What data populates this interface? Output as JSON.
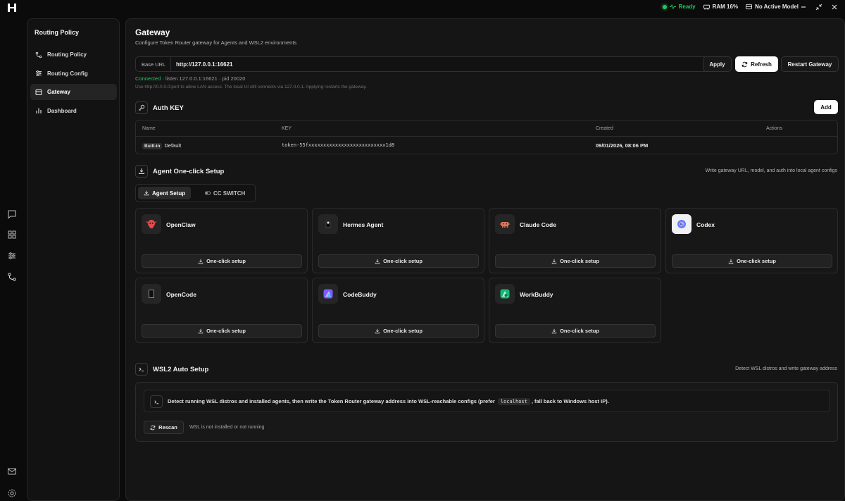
{
  "topbar": {
    "status": "Ready",
    "ram": "RAM 16%",
    "model": "No Active Model"
  },
  "sidebar": {
    "title": "Routing Policy",
    "items": [
      {
        "label": "Routing Policy",
        "icon": "route-icon"
      },
      {
        "label": "Routing Config",
        "icon": "sliders-icon"
      },
      {
        "label": "Gateway",
        "icon": "gateway-icon",
        "active": true
      },
      {
        "label": "Dashboard",
        "icon": "bar-chart-icon"
      }
    ]
  },
  "gateway": {
    "title": "Gateway",
    "subtitle": "Configure Token Router gateway for Agents and WSL2 environments",
    "base_url_label": "Base URL",
    "base_url_value": "http://127.0.0.1:16621",
    "apply_label": "Apply",
    "refresh_label": "Refresh",
    "restart_label": "Restart Gateway",
    "connected": "Connected",
    "listen_info": " · listen 127.0.0.1:16621 · pid 20020",
    "hint": "Use http://0.0.0.0:port to allow LAN access. The local UI still connects via 127.0.0.1. Applying restarts the gateway."
  },
  "auth": {
    "title": "Auth KEY",
    "add_label": "Add",
    "columns": [
      "Name",
      "KEY",
      "Created",
      "Actions"
    ],
    "rows": [
      {
        "badge": "Built-in",
        "name": "Default",
        "key": "token-55fxxxxxxxxxxxxxxxxxxxxxxxxxx1d8",
        "created": "09/01/2026, 08:06 PM"
      }
    ]
  },
  "agent_setup": {
    "title": "Agent One-click Setup",
    "description": "Write gateway URL, model, and auth into local agent configs",
    "tabs": [
      "Agent Setup",
      "CC SWITCH"
    ],
    "button_label": "One-click setup",
    "agents": [
      {
        "name": "OpenClaw",
        "icon": "openclaw-icon",
        "color": "#e5484d"
      },
      {
        "name": "Hermes Agent",
        "icon": "hermes-icon",
        "color": "#1a1a1a"
      },
      {
        "name": "Claude Code",
        "icon": "claude-icon",
        "color": "#d97757"
      },
      {
        "name": "Codex",
        "icon": "codex-icon",
        "color": "#6b7cff"
      },
      {
        "name": "OpenCode",
        "icon": "opencode-icon",
        "color": "#0f0f0f"
      },
      {
        "name": "CodeBuddy",
        "icon": "codebuddy-icon",
        "color": "#7c5cff"
      },
      {
        "name": "WorkBuddy",
        "icon": "workbuddy-icon",
        "color": "#18b87a"
      }
    ]
  },
  "wsl": {
    "title": "WSL2 Auto Setup",
    "description": "Detect WSL distros and write gateway address",
    "text_before": "Detect running WSL distros and installed agents, then write the Token Router gateway address into WSL-reachable configs (prefer",
    "code": "localhost",
    "text_after": ", fall back to Windows host IP).",
    "rescan_label": "Rescan",
    "status": "WSL is not installed or not running"
  }
}
